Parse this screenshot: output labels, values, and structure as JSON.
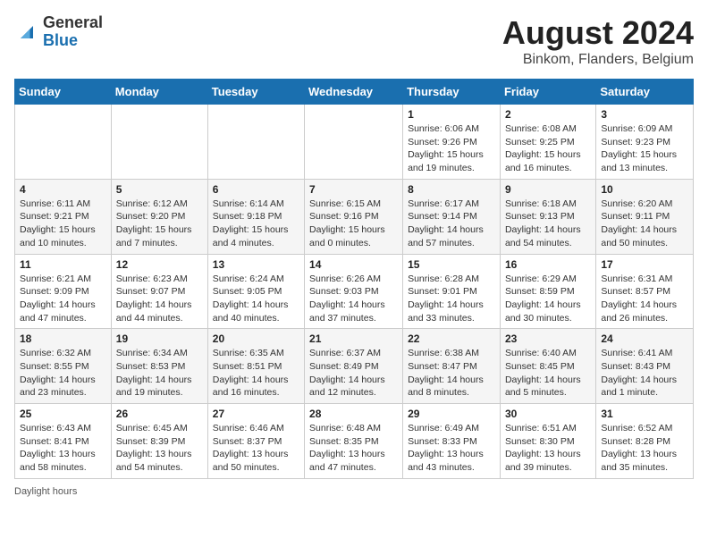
{
  "header": {
    "logo_general": "General",
    "logo_blue": "Blue",
    "title": "August 2024",
    "subtitle": "Binkom, Flanders, Belgium"
  },
  "weekdays": [
    "Sunday",
    "Monday",
    "Tuesday",
    "Wednesday",
    "Thursday",
    "Friday",
    "Saturday"
  ],
  "weeks": [
    [
      {
        "day": "",
        "info": ""
      },
      {
        "day": "",
        "info": ""
      },
      {
        "day": "",
        "info": ""
      },
      {
        "day": "",
        "info": ""
      },
      {
        "day": "1",
        "info": "Sunrise: 6:06 AM\nSunset: 9:26 PM\nDaylight: 15 hours\nand 19 minutes."
      },
      {
        "day": "2",
        "info": "Sunrise: 6:08 AM\nSunset: 9:25 PM\nDaylight: 15 hours\nand 16 minutes."
      },
      {
        "day": "3",
        "info": "Sunrise: 6:09 AM\nSunset: 9:23 PM\nDaylight: 15 hours\nand 13 minutes."
      }
    ],
    [
      {
        "day": "4",
        "info": "Sunrise: 6:11 AM\nSunset: 9:21 PM\nDaylight: 15 hours\nand 10 minutes."
      },
      {
        "day": "5",
        "info": "Sunrise: 6:12 AM\nSunset: 9:20 PM\nDaylight: 15 hours\nand 7 minutes."
      },
      {
        "day": "6",
        "info": "Sunrise: 6:14 AM\nSunset: 9:18 PM\nDaylight: 15 hours\nand 4 minutes."
      },
      {
        "day": "7",
        "info": "Sunrise: 6:15 AM\nSunset: 9:16 PM\nDaylight: 15 hours\nand 0 minutes."
      },
      {
        "day": "8",
        "info": "Sunrise: 6:17 AM\nSunset: 9:14 PM\nDaylight: 14 hours\nand 57 minutes."
      },
      {
        "day": "9",
        "info": "Sunrise: 6:18 AM\nSunset: 9:13 PM\nDaylight: 14 hours\nand 54 minutes."
      },
      {
        "day": "10",
        "info": "Sunrise: 6:20 AM\nSunset: 9:11 PM\nDaylight: 14 hours\nand 50 minutes."
      }
    ],
    [
      {
        "day": "11",
        "info": "Sunrise: 6:21 AM\nSunset: 9:09 PM\nDaylight: 14 hours\nand 47 minutes."
      },
      {
        "day": "12",
        "info": "Sunrise: 6:23 AM\nSunset: 9:07 PM\nDaylight: 14 hours\nand 44 minutes."
      },
      {
        "day": "13",
        "info": "Sunrise: 6:24 AM\nSunset: 9:05 PM\nDaylight: 14 hours\nand 40 minutes."
      },
      {
        "day": "14",
        "info": "Sunrise: 6:26 AM\nSunset: 9:03 PM\nDaylight: 14 hours\nand 37 minutes."
      },
      {
        "day": "15",
        "info": "Sunrise: 6:28 AM\nSunset: 9:01 PM\nDaylight: 14 hours\nand 33 minutes."
      },
      {
        "day": "16",
        "info": "Sunrise: 6:29 AM\nSunset: 8:59 PM\nDaylight: 14 hours\nand 30 minutes."
      },
      {
        "day": "17",
        "info": "Sunrise: 6:31 AM\nSunset: 8:57 PM\nDaylight: 14 hours\nand 26 minutes."
      }
    ],
    [
      {
        "day": "18",
        "info": "Sunrise: 6:32 AM\nSunset: 8:55 PM\nDaylight: 14 hours\nand 23 minutes."
      },
      {
        "day": "19",
        "info": "Sunrise: 6:34 AM\nSunset: 8:53 PM\nDaylight: 14 hours\nand 19 minutes."
      },
      {
        "day": "20",
        "info": "Sunrise: 6:35 AM\nSunset: 8:51 PM\nDaylight: 14 hours\nand 16 minutes."
      },
      {
        "day": "21",
        "info": "Sunrise: 6:37 AM\nSunset: 8:49 PM\nDaylight: 14 hours\nand 12 minutes."
      },
      {
        "day": "22",
        "info": "Sunrise: 6:38 AM\nSunset: 8:47 PM\nDaylight: 14 hours\nand 8 minutes."
      },
      {
        "day": "23",
        "info": "Sunrise: 6:40 AM\nSunset: 8:45 PM\nDaylight: 14 hours\nand 5 minutes."
      },
      {
        "day": "24",
        "info": "Sunrise: 6:41 AM\nSunset: 8:43 PM\nDaylight: 14 hours\nand 1 minute."
      }
    ],
    [
      {
        "day": "25",
        "info": "Sunrise: 6:43 AM\nSunset: 8:41 PM\nDaylight: 13 hours\nand 58 minutes."
      },
      {
        "day": "26",
        "info": "Sunrise: 6:45 AM\nSunset: 8:39 PM\nDaylight: 13 hours\nand 54 minutes."
      },
      {
        "day": "27",
        "info": "Sunrise: 6:46 AM\nSunset: 8:37 PM\nDaylight: 13 hours\nand 50 minutes."
      },
      {
        "day": "28",
        "info": "Sunrise: 6:48 AM\nSunset: 8:35 PM\nDaylight: 13 hours\nand 47 minutes."
      },
      {
        "day": "29",
        "info": "Sunrise: 6:49 AM\nSunset: 8:33 PM\nDaylight: 13 hours\nand 43 minutes."
      },
      {
        "day": "30",
        "info": "Sunrise: 6:51 AM\nSunset: 8:30 PM\nDaylight: 13 hours\nand 39 minutes."
      },
      {
        "day": "31",
        "info": "Sunrise: 6:52 AM\nSunset: 8:28 PM\nDaylight: 13 hours\nand 35 minutes."
      }
    ]
  ],
  "footer": {
    "daylight_label": "Daylight hours"
  }
}
